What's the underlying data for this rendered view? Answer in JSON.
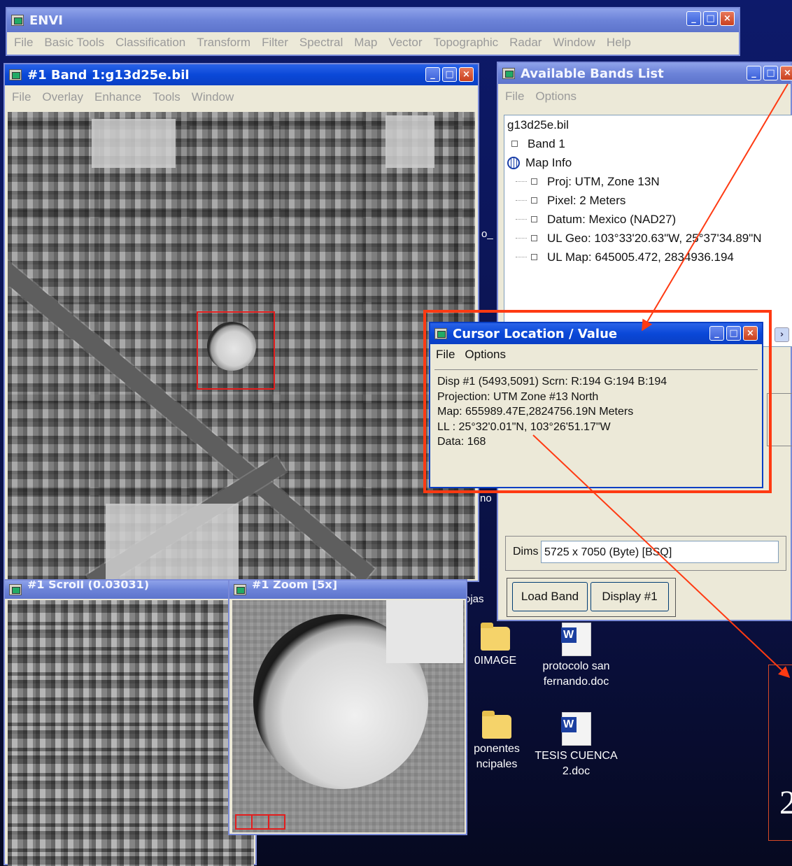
{
  "envi": {
    "title": "ENVI",
    "menu": [
      "File",
      "Basic Tools",
      "Classification",
      "Transform",
      "Filter",
      "Spectral",
      "Map",
      "Vector",
      "Topographic",
      "Radar",
      "Window",
      "Help"
    ]
  },
  "image_window": {
    "title": "#1 Band 1:g13d25e.bil",
    "menu": [
      "File",
      "Overlay",
      "Enhance",
      "Tools",
      "Window"
    ]
  },
  "scroll_window": {
    "title": "#1 Scroll (0.03031)"
  },
  "zoom_window": {
    "title": "#1 Zoom [5x]"
  },
  "bands_window": {
    "title": "Available Bands List",
    "menu": [
      "File",
      "Options"
    ],
    "tree": {
      "file": "g13d25e.bil",
      "band": "Band 1",
      "map_info": "Map Info",
      "items": [
        "Proj: UTM, Zone 13N",
        "Pixel: 2 Meters",
        "Datum: Mexico (NAD27)",
        "UL Geo: 103°33'20.63\"W, 25°37'34.89\"N",
        "UL Map: 645005.472, 2834936.194"
      ]
    },
    "dims_label": "Dims",
    "dims_value": "5725 x 7050 (Byte) [BSQ]",
    "load_band": "Load Band",
    "display": "Display #1"
  },
  "cursor_window": {
    "title": "Cursor Location / Value",
    "menu": [
      "File",
      "Options"
    ],
    "lines": [
      "Disp #1 (5493,5091) Scrn: R:194 G:194 B:194",
      "Projection: UTM Zone #13 North",
      "Map: 655989.47E,2824756.19N Meters",
      "LL : 25°32'0.01\"N, 103°26'51.17\"W",
      "Data: 168"
    ]
  },
  "desktop_icons": [
    {
      "label": "0IMAGE",
      "type": "folder"
    },
    {
      "label": "protocolo san fernando.doc",
      "type": "word-doc"
    },
    {
      "label": "ponentes\nncipales",
      "type": "folder"
    },
    {
      "label": "TESIS CUENCA 2.doc",
      "type": "word-doc"
    }
  ],
  "partial_texts": {
    "hidden_label_jas": "ojas",
    "hidden_label_no": "no",
    "hidden_label_o": "o_",
    "callout_digit": "2"
  },
  "colors": {
    "highlight": "#e31d1d",
    "title_active": "#0a48d8",
    "title_inactive": "#6c83d8",
    "window_bg": "#ece9d8"
  }
}
